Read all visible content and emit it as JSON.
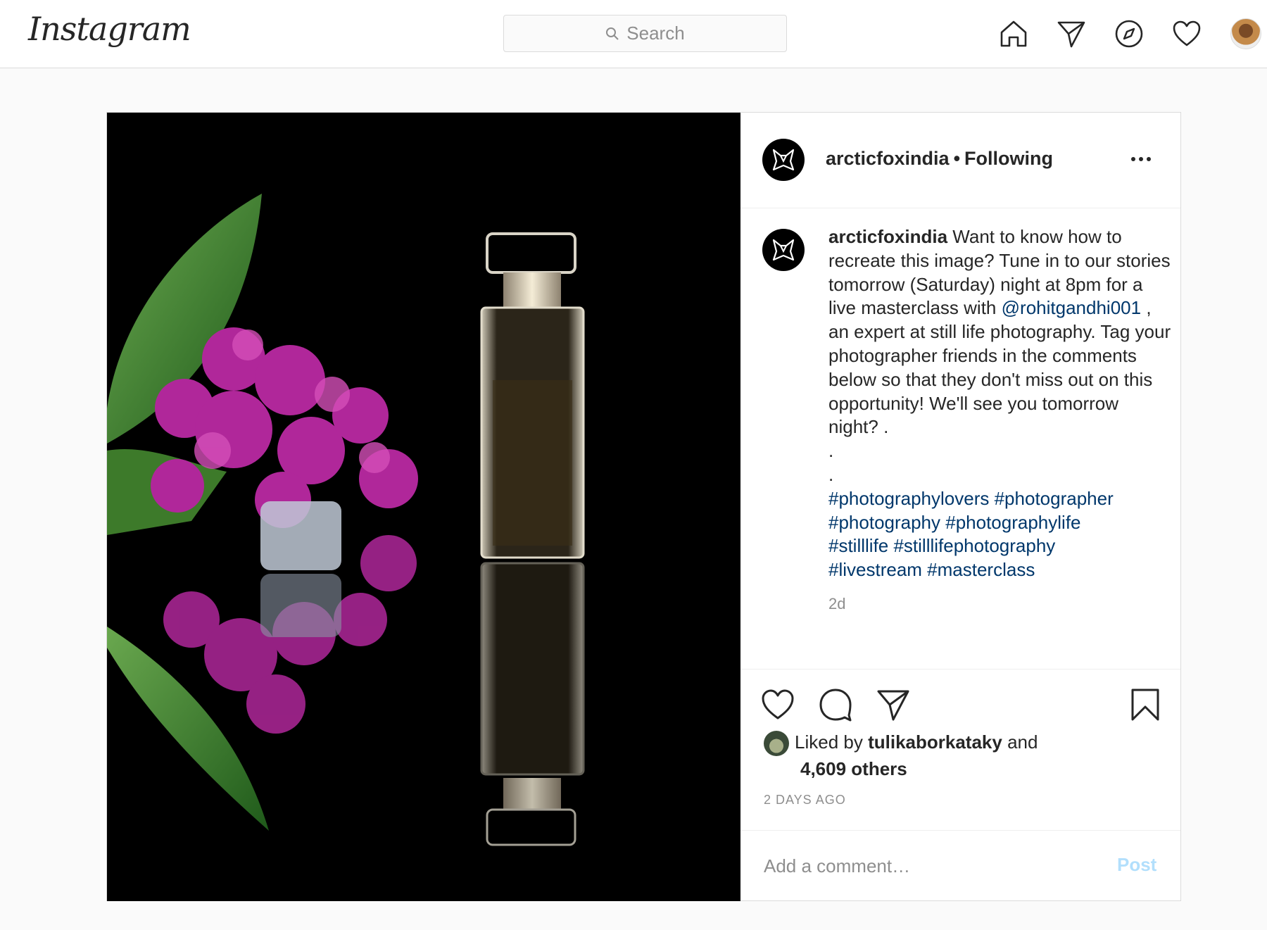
{
  "topbar": {
    "logo": "Instagram",
    "search_placeholder": "Search",
    "icons": [
      "home-icon",
      "direct-icon",
      "explore-icon",
      "activity-icon",
      "profile-avatar"
    ]
  },
  "post": {
    "username": "arcticfoxindia",
    "follow_status": "Following",
    "caption": {
      "username": "arcticfoxindia",
      "text_part1": "Want to know how to recreate this image? Tune in to our stories tomorrow (Saturday) night at 8pm for a live masterclass with",
      "mention": "@rohitgandhi001",
      "text_part2": ", an expert at still life photography. Tag your photographer friends in the comments below so that they don't miss out on this opportunity! We'll see you tomorrow night? .",
      "dot1": ".",
      "dot2": ".",
      "hashtags_line1": "#photographylovers #photographer",
      "hashtags_line2": "#photography #photographylife",
      "hashtags_line3": "#stilllife #stilllifephotography",
      "hashtags_line4": "#livestream #masterclass",
      "time": "2d"
    },
    "likes": {
      "prefix": "Liked by",
      "user": "tulikaborkataky",
      "and": "and",
      "others": "4,609 others"
    },
    "posted_ago": "2 DAYS AGO",
    "comment_placeholder": "Add a comment…",
    "post_label": "Post"
  },
  "colors": {
    "link": "#00376b",
    "muted": "#8e8e8e",
    "post_button_disabled": "#b2dffc"
  }
}
